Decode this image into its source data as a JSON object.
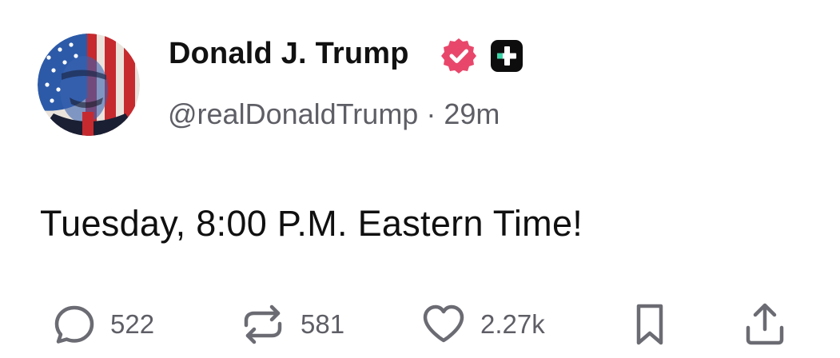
{
  "author": {
    "display_name": "Donald J. Trump",
    "handle": "@realDonaldTrump",
    "separator": "·",
    "time_ago": "29m",
    "verified_color": "#e8476b",
    "plus_badge_color": "#0d0d0d",
    "plus_badge_accent": "#3ad6a8"
  },
  "post": {
    "text": "Tuesday, 8:00 P.M. Eastern Time!"
  },
  "actions": {
    "reply_count": "522",
    "repost_count": "581",
    "like_count": "2.27k",
    "icon_color": "#6b6b73"
  }
}
